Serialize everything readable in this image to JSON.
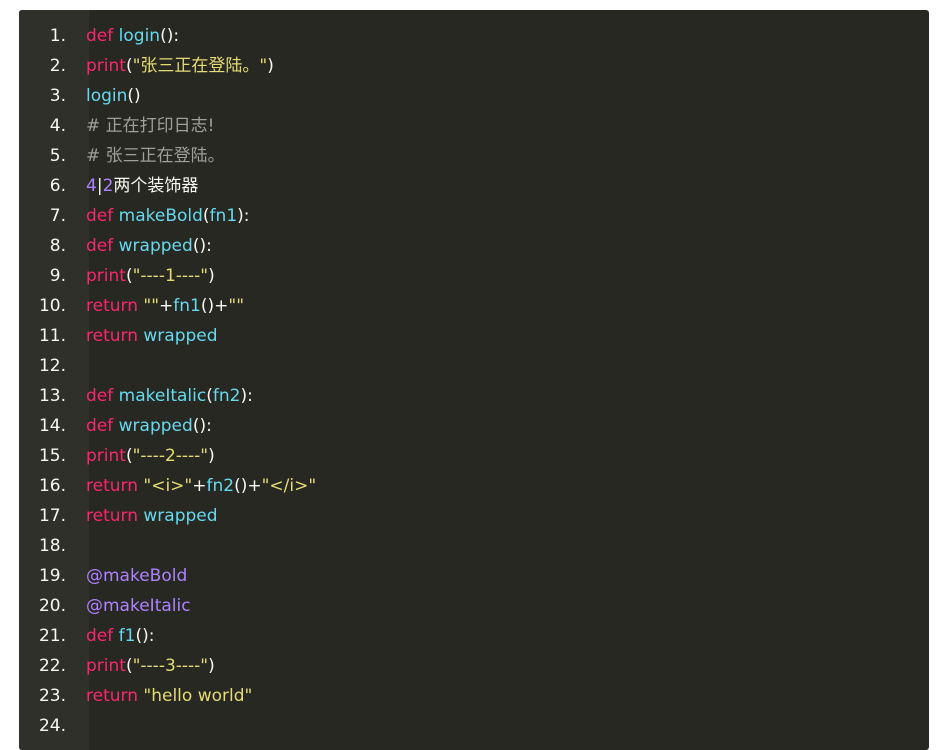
{
  "code": {
    "lines": [
      {
        "num": "1.",
        "tokens": [
          [
            "kw",
            "def"
          ],
          [
            "pl",
            " "
          ],
          [
            "fn",
            "login"
          ],
          [
            "pl",
            "():"
          ]
        ]
      },
      {
        "num": "2.",
        "tokens": [
          [
            "kw",
            "print"
          ],
          [
            "pl",
            "("
          ],
          [
            "str",
            "\"张三正在登陆。\""
          ],
          [
            "pl",
            ")"
          ]
        ]
      },
      {
        "num": "3.",
        "tokens": [
          [
            "fn",
            "login"
          ],
          [
            "pl",
            "()"
          ]
        ]
      },
      {
        "num": "4.",
        "tokens": [
          [
            "cm",
            "# 正在打印日志!"
          ]
        ]
      },
      {
        "num": "5.",
        "tokens": [
          [
            "cm",
            "# 张三正在登陆。"
          ]
        ]
      },
      {
        "num": "6.",
        "tokens": [
          [
            "num",
            "4"
          ],
          [
            "pl",
            "|"
          ],
          [
            "num",
            "2"
          ],
          [
            "pl",
            "两个装饰器"
          ]
        ]
      },
      {
        "num": "7.",
        "tokens": [
          [
            "kw",
            "def"
          ],
          [
            "pl",
            " "
          ],
          [
            "fn",
            "makeBold"
          ],
          [
            "pl",
            "("
          ],
          [
            "fn",
            "fn1"
          ],
          [
            "pl",
            "):"
          ]
        ]
      },
      {
        "num": "8.",
        "tokens": [
          [
            "kw",
            "def"
          ],
          [
            "pl",
            " "
          ],
          [
            "fn",
            "wrapped"
          ],
          [
            "pl",
            "():"
          ]
        ]
      },
      {
        "num": "9.",
        "tokens": [
          [
            "kw",
            "print"
          ],
          [
            "pl",
            "("
          ],
          [
            "str",
            "\"----1----\""
          ],
          [
            "pl",
            ")"
          ]
        ]
      },
      {
        "num": "10.",
        "tokens": [
          [
            "kw",
            "return"
          ],
          [
            "pl",
            " "
          ],
          [
            "str",
            "\"\""
          ],
          [
            "pl",
            "+"
          ],
          [
            "fn",
            "fn1"
          ],
          [
            "pl",
            "()+"
          ],
          [
            "str",
            "\"\""
          ]
        ]
      },
      {
        "num": "11.",
        "tokens": [
          [
            "kw",
            "return"
          ],
          [
            "pl",
            " "
          ],
          [
            "fn",
            "wrapped"
          ]
        ]
      },
      {
        "num": "12.",
        "tokens": []
      },
      {
        "num": "13.",
        "tokens": [
          [
            "kw",
            "def"
          ],
          [
            "pl",
            " "
          ],
          [
            "fn",
            "makeItalic"
          ],
          [
            "pl",
            "("
          ],
          [
            "fn",
            "fn2"
          ],
          [
            "pl",
            "):"
          ]
        ]
      },
      {
        "num": "14.",
        "tokens": [
          [
            "kw",
            "def"
          ],
          [
            "pl",
            " "
          ],
          [
            "fn",
            "wrapped"
          ],
          [
            "pl",
            "():"
          ]
        ]
      },
      {
        "num": "15.",
        "tokens": [
          [
            "kw",
            "print"
          ],
          [
            "pl",
            "("
          ],
          [
            "str",
            "\"----2----\""
          ],
          [
            "pl",
            ")"
          ]
        ]
      },
      {
        "num": "16.",
        "tokens": [
          [
            "kw",
            "return"
          ],
          [
            "pl",
            " "
          ],
          [
            "str",
            "\"<i>\""
          ],
          [
            "pl",
            "+"
          ],
          [
            "fn",
            "fn2"
          ],
          [
            "pl",
            "()+"
          ],
          [
            "str",
            "\"</i>\""
          ]
        ]
      },
      {
        "num": "17.",
        "tokens": [
          [
            "kw",
            "return"
          ],
          [
            "pl",
            " "
          ],
          [
            "fn",
            "wrapped"
          ]
        ]
      },
      {
        "num": "18.",
        "tokens": []
      },
      {
        "num": "19.",
        "tokens": [
          [
            "dec",
            "@makeBold"
          ]
        ]
      },
      {
        "num": "20.",
        "tokens": [
          [
            "dec",
            "@makeItalic"
          ]
        ]
      },
      {
        "num": "21.",
        "tokens": [
          [
            "kw",
            "def"
          ],
          [
            "pl",
            " "
          ],
          [
            "fn",
            "f1"
          ],
          [
            "pl",
            "():"
          ]
        ]
      },
      {
        "num": "22.",
        "tokens": [
          [
            "kw",
            "print"
          ],
          [
            "pl",
            "("
          ],
          [
            "str",
            "\"----3----\""
          ],
          [
            "pl",
            ")"
          ]
        ]
      },
      {
        "num": "23.",
        "tokens": [
          [
            "kw",
            "return"
          ],
          [
            "pl",
            " "
          ],
          [
            "str",
            "\"hello world\""
          ]
        ]
      },
      {
        "num": "24.",
        "tokens": []
      }
    ]
  },
  "colors": {
    "background": "#272822",
    "gutter": "#30302a",
    "keyword": "#f92672",
    "function": "#66d9ef",
    "string": "#e6db74",
    "comment": "#a09f99",
    "number": "#ae81ff",
    "plain": "#f8f8f2"
  }
}
